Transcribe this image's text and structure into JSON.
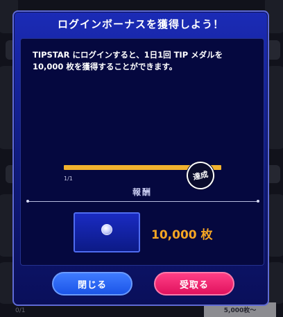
{
  "modal": {
    "title": "ログインボーナスを獲得しよう！",
    "description": "TIPSTAR にログインすると、1日1回 TIP メダルを 10,000 枚を獲得することができます。",
    "progress": {
      "count_text": "1/1",
      "fraction": 1.0,
      "achieved_label": "達成",
      "fill_color": "#f2b22e"
    },
    "reward": {
      "label": "報酬",
      "icon": "medal-icon",
      "amount": "10,000 枚",
      "amount_color": "#f5a623"
    },
    "buttons": {
      "close": "閉じる",
      "receive": "受取る"
    }
  },
  "background": {
    "footer_left": "0/1",
    "footer_right": "5,000枚〜"
  }
}
